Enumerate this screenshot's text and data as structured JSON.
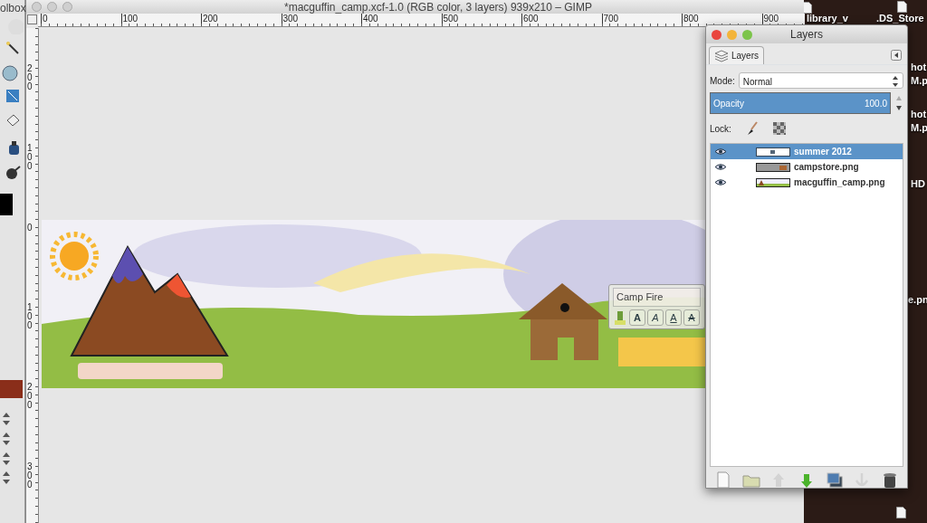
{
  "toolbox": {
    "title": "olbox"
  },
  "image_window": {
    "title": "*macguffin_camp.xcf-1.0 (RGB color, 3 layers) 939x210 – GIMP",
    "hruler": [
      "0",
      "100",
      "200",
      "300",
      "400",
      "500",
      "600",
      "700",
      "800",
      "900"
    ],
    "vruler": [
      "200",
      "100",
      "0",
      "100",
      "200",
      "300"
    ]
  },
  "text_toolbar": {
    "font": "Camp Fire",
    "buttons": [
      {
        "kind": "bold",
        "label": "A"
      },
      {
        "kind": "italic",
        "label": "A"
      },
      {
        "kind": "underline",
        "label": "A"
      },
      {
        "kind": "strike",
        "label": "A"
      }
    ]
  },
  "layers": {
    "title": "Layers",
    "tab": "Layers",
    "mode_label": "Mode:",
    "mode": "Normal",
    "opacity_label": "Opacity",
    "opacity": "100.0",
    "level": 1,
    "lock_label": "Lock:",
    "items": [
      {
        "name": "summer 2012",
        "kind": "text",
        "selected": true,
        "visible": true
      },
      {
        "name": "campstore.png",
        "kind": "store",
        "selected": false,
        "visible": true
      },
      {
        "name": "macguffin_camp.png",
        "kind": "banner",
        "selected": false,
        "visible": true
      }
    ],
    "buttons": [
      {
        "kind": "new",
        "disabled": false
      },
      {
        "kind": "folder",
        "disabled": false
      },
      {
        "kind": "raise",
        "disabled": true
      },
      {
        "kind": "lower",
        "disabled": false
      },
      {
        "kind": "duplicate",
        "disabled": false
      },
      {
        "kind": "anchor",
        "disabled": true
      },
      {
        "kind": "delete",
        "disabled": false
      }
    ]
  },
  "desktop": {
    "labels": [
      "library_v",
      ".DS_Store",
      "hot",
      "M.p",
      "hot",
      "M.p",
      "HD",
      "e.pn"
    ]
  }
}
